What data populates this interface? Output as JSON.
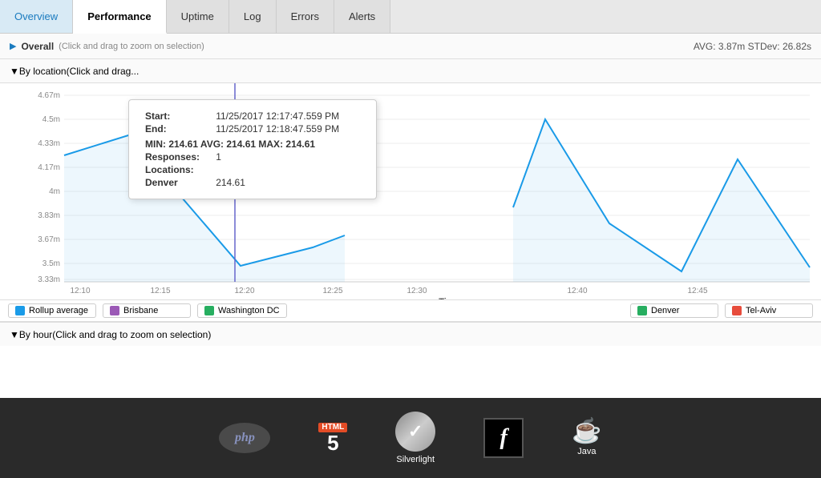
{
  "nav": {
    "tabs": [
      {
        "label": "Overview",
        "active": false
      },
      {
        "label": "Performance",
        "active": true
      },
      {
        "label": "Uptime",
        "active": false
      },
      {
        "label": "Log",
        "active": false
      },
      {
        "label": "Errors",
        "active": false
      },
      {
        "label": "Alerts",
        "active": false
      }
    ]
  },
  "overall_section": {
    "title": "Overall",
    "hint": "(Click and drag to zoom on selection)",
    "stats": "AVG: 3.87m  STDev: 26.82s",
    "toggle": "▶"
  },
  "by_location_section": {
    "title": "By location",
    "hint": "(Click and drag...",
    "toggle": "▼"
  },
  "tooltip": {
    "start_label": "Start:",
    "start_value": "11/25/2017 12:17:47.559 PM",
    "end_label": "End:",
    "end_value": "11/25/2017 12:18:47.559 PM",
    "stats_label": "MIN: 214.61  AVG: 214.61  MAX: 214.61",
    "responses_label": "Responses:",
    "responses_value": "1",
    "locations_label": "Locations:",
    "location_name": "Denver",
    "location_value": "214.61"
  },
  "y_axis": {
    "labels": [
      "4.67m",
      "4.5m",
      "4.33m",
      "4.17m",
      "4m",
      "3.83m",
      "3.67m",
      "3.5m",
      "3.33m"
    ]
  },
  "x_axis": {
    "labels": [
      "12:10",
      "12:15",
      "12:20",
      "12:25",
      "12:30",
      "12:40",
      "12:45"
    ]
  },
  "x_label": "Time",
  "legend_left": [
    {
      "color": "#1a9be8",
      "label": "Rollup average"
    },
    {
      "color": "#9b59b6",
      "label": "Brisbane"
    },
    {
      "color": "#27ae60",
      "label": "Washington DC"
    }
  ],
  "legend_right": [
    {
      "color": "#27ae60",
      "label": "Denver"
    },
    {
      "color": "#e74c3c",
      "label": "Tel-Aviv"
    }
  ],
  "by_hour": {
    "title": "By hour",
    "hint": "(Click and drag to zoom on selection)",
    "toggle": "▼"
  },
  "footer": {
    "icons": [
      {
        "name": "php",
        "label": ""
      },
      {
        "name": "html5",
        "label": ""
      },
      {
        "name": "silverlight",
        "label": "Silverlight"
      },
      {
        "name": "flash",
        "label": ""
      },
      {
        "name": "java",
        "label": "Java"
      }
    ]
  }
}
